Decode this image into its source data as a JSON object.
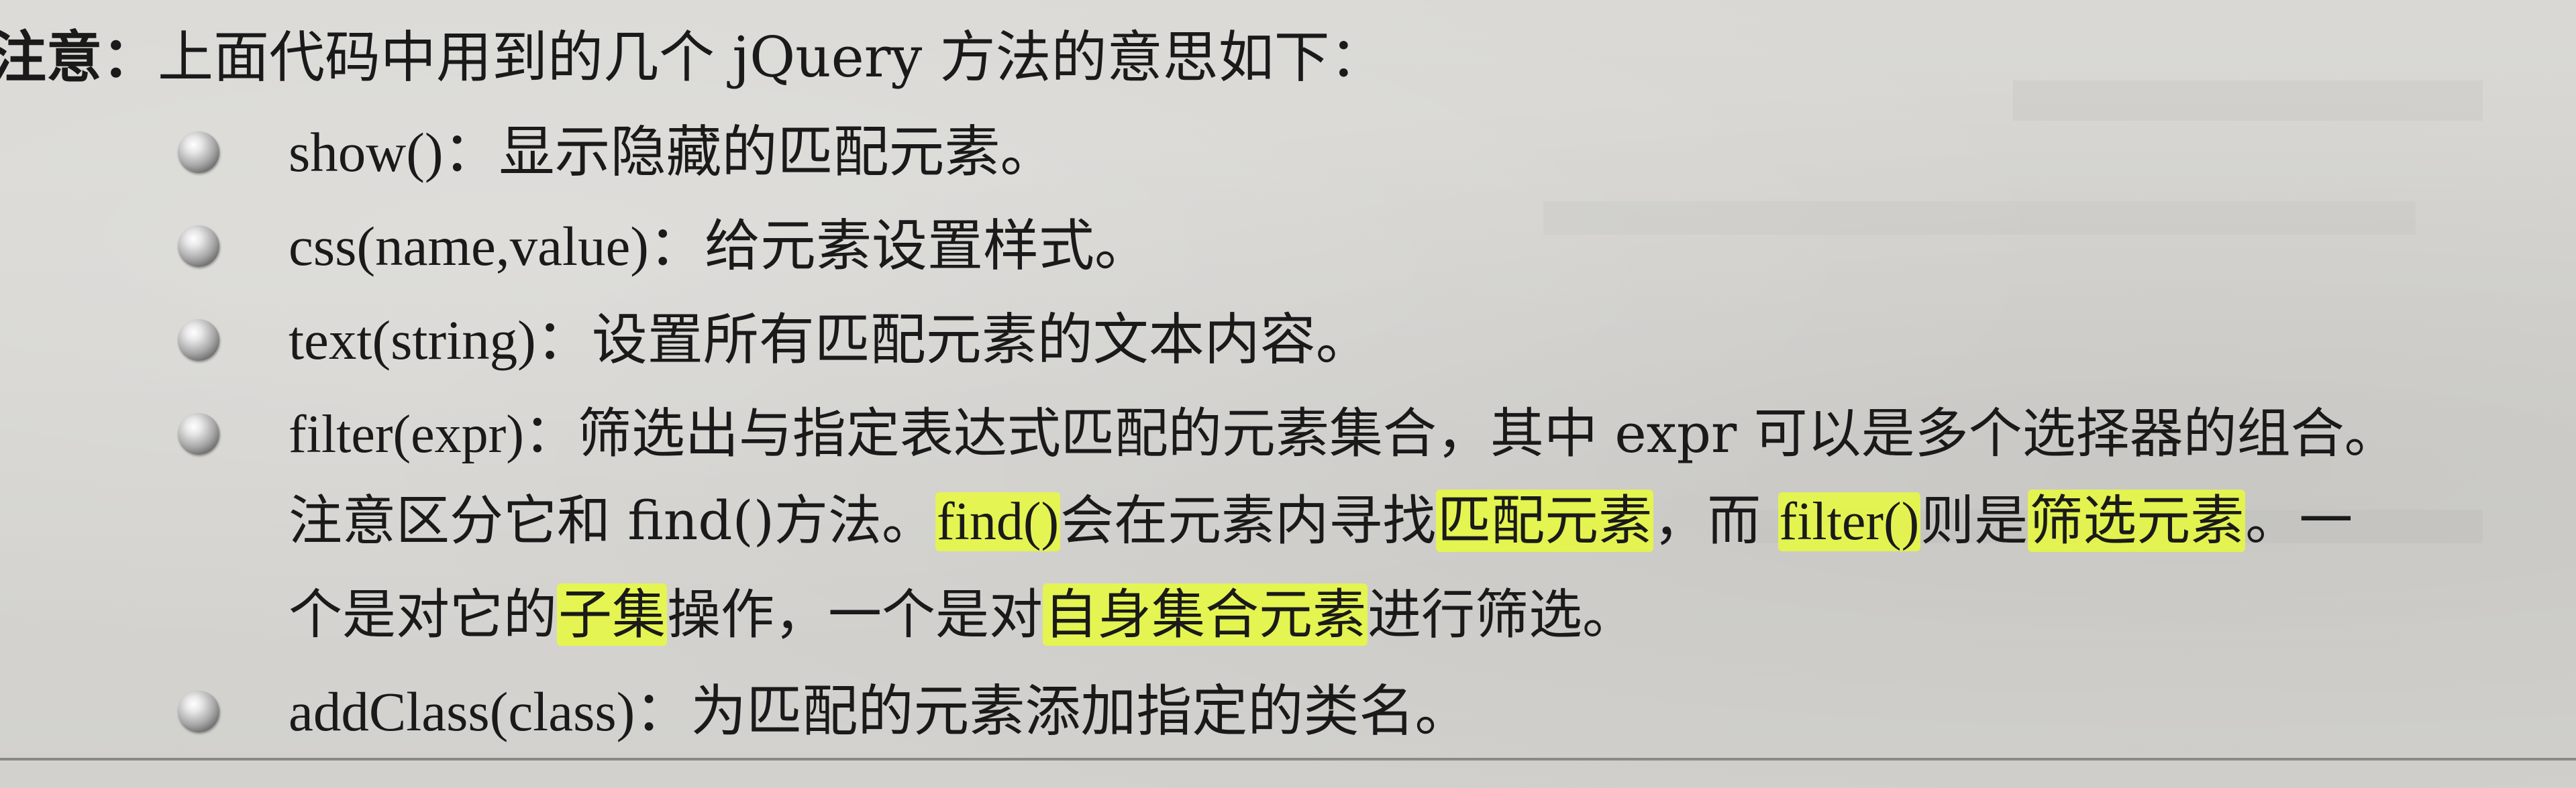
{
  "note": {
    "label": "注意：",
    "text": "上面代码中用到的几个 jQuery 方法的意思如下："
  },
  "items": [
    {
      "method": "show()",
      "sep": "：",
      "desc": "显示隐藏的匹配元素。"
    },
    {
      "method": "css(name,value)",
      "sep": "：",
      "desc": "给元素设置样式。"
    },
    {
      "method": "text(string)",
      "sep": "：",
      "desc": "设置所有匹配元素的文本内容。"
    },
    {
      "method": "filter(expr)",
      "sep": "：",
      "desc": "筛选出与指定表达式匹配的元素集合，其中 expr 可以是多个选择器的组合。"
    },
    {
      "method": "addClass(class)",
      "sep": "：",
      "desc": "为匹配的元素添加指定的类名。"
    }
  ],
  "filter_note": {
    "line1": {
      "a": "注意区分它和 find()方法。",
      "b": "find()",
      "c": "会在",
      "d": "元素内寻找",
      "e": "匹配元素",
      "f": "，而 ",
      "g": "filter()",
      "h": "则是",
      "i": "筛选元素",
      "j": "。一"
    },
    "line2": {
      "a": "个是对它的",
      "b": "子集",
      "c": "操作，一个是对",
      "d": "自身集合元素",
      "e": "进行筛选。"
    }
  },
  "colors": {
    "highlight": "#e8fa3c",
    "paper": "#d6d5d1",
    "text": "#1a1a1a"
  }
}
